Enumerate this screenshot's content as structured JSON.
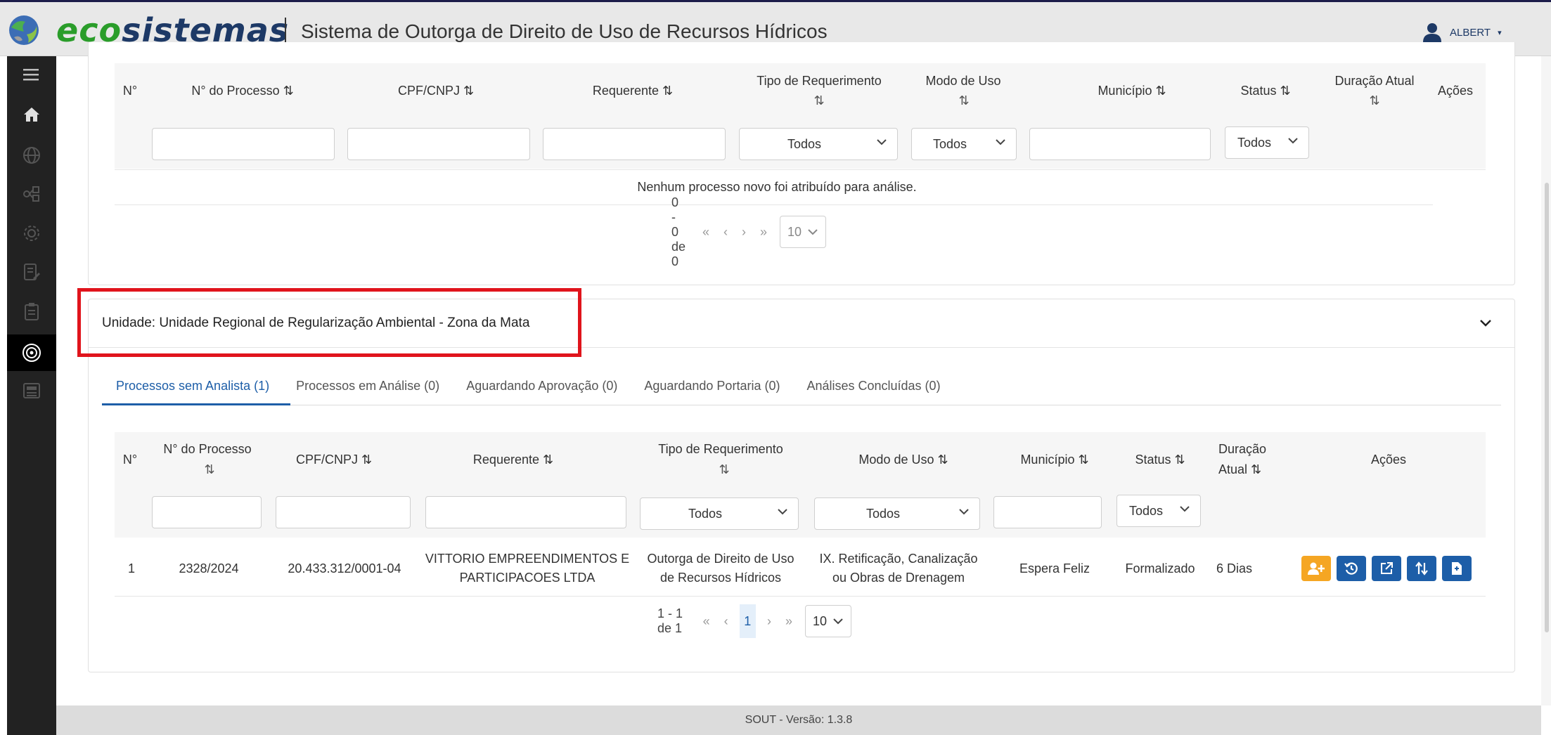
{
  "header": {
    "brand_eco": "eco",
    "brand_sistemas": "sistemas",
    "title": "Sistema de Outorga de Direito de Uso de Recursos Hídricos",
    "user_name": "ALBERT"
  },
  "sidebar": {
    "items": [
      {
        "icon": "menu-icon"
      },
      {
        "icon": "home-icon"
      },
      {
        "icon": "globe-icon"
      },
      {
        "icon": "network-icon"
      },
      {
        "icon": "settings-icon"
      },
      {
        "icon": "edit-document-icon"
      },
      {
        "icon": "clipboard-icon"
      },
      {
        "icon": "target-icon",
        "active": true
      },
      {
        "icon": "newspaper-icon"
      }
    ]
  },
  "table1": {
    "headers": {
      "num": "N°",
      "processo": "N° do Processo ⇅",
      "cpf": "CPF/CNPJ ⇅",
      "requerente": "Requerente ⇅",
      "tipo": "Tipo de Requerimento",
      "tipo_sort": "⇅",
      "modo": "Modo de Uso",
      "modo_sort": "⇅",
      "municipio": "Município ⇅",
      "status": "Status ⇅",
      "duracao": "Duração Atual",
      "duracao_sort": "⇅",
      "acoes": "Ações"
    },
    "filters": {
      "tipo": "Todos",
      "modo": "Todos",
      "status": "Todos"
    },
    "empty_message": "Nenhum processo novo foi atribuído para análise.",
    "pager": {
      "range": "0 - 0 de 0",
      "page_size": "10"
    }
  },
  "unit": {
    "title": "Unidade: Unidade Regional de Regularização Ambiental - Zona da Mata"
  },
  "tabs": [
    {
      "label": "Processos sem Analista (1)",
      "active": true
    },
    {
      "label": "Processos em Análise (0)"
    },
    {
      "label": "Aguardando Aprovação (0)"
    },
    {
      "label": "Aguardando Portaria (0)"
    },
    {
      "label": "Análises Concluídas (0)"
    }
  ],
  "table2": {
    "headers": {
      "num": "N°",
      "processo": "N° do Processo",
      "processo_sort": "⇅",
      "cpf": "CPF/CNPJ ⇅",
      "requerente": "Requerente ⇅",
      "tipo": "Tipo de Requerimento",
      "tipo_sort": "⇅",
      "modo": "Modo de Uso ⇅",
      "municipio": "Município ⇅",
      "status": "Status ⇅",
      "duracao": "Duração",
      "duracao2": "Atual ⇅",
      "acoes": "Ações"
    },
    "filters": {
      "tipo": "Todos",
      "modo": "Todos",
      "status": "Todos"
    },
    "rows": [
      {
        "num": "1",
        "processo": "2328/2024",
        "cpf": "20.433.312/0001-04",
        "requerente_l1": "VITTORIO EMPREENDIMENTOS E",
        "requerente_l2": "PARTICIPACOES LTDA",
        "tipo_l1": "Outorga de Direito de Uso",
        "tipo_l2": "de Recursos Hídricos",
        "modo_l1": "IX. Retificação, Canalização",
        "modo_l2": "ou Obras de Drenagem",
        "municipio": "Espera Feliz",
        "status": "Formalizado",
        "duracao": "6 Dias"
      }
    ],
    "pager": {
      "range": "1 - 1 de 1",
      "current": "1",
      "page_size": "10"
    }
  },
  "footer": {
    "version": "SOUT - Versão: 1.3.8"
  },
  "colors": {
    "primary": "#1d5ea8",
    "orange": "#f5a623",
    "highlight": "#e0141c",
    "sidebar": "#222222"
  }
}
